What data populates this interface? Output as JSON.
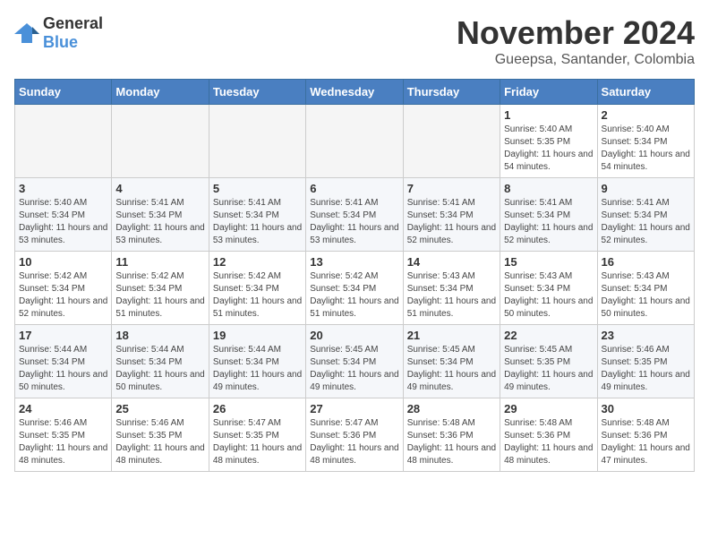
{
  "logo": {
    "general": "General",
    "blue": "Blue"
  },
  "title": "November 2024",
  "location": "Gueepsa, Santander, Colombia",
  "weekdays": [
    "Sunday",
    "Monday",
    "Tuesday",
    "Wednesday",
    "Thursday",
    "Friday",
    "Saturday"
  ],
  "weeks": [
    [
      {
        "day": "",
        "info": ""
      },
      {
        "day": "",
        "info": ""
      },
      {
        "day": "",
        "info": ""
      },
      {
        "day": "",
        "info": ""
      },
      {
        "day": "",
        "info": ""
      },
      {
        "day": "1",
        "info": "Sunrise: 5:40 AM\nSunset: 5:35 PM\nDaylight: 11 hours and 54 minutes."
      },
      {
        "day": "2",
        "info": "Sunrise: 5:40 AM\nSunset: 5:34 PM\nDaylight: 11 hours and 54 minutes."
      }
    ],
    [
      {
        "day": "3",
        "info": "Sunrise: 5:40 AM\nSunset: 5:34 PM\nDaylight: 11 hours and 53 minutes."
      },
      {
        "day": "4",
        "info": "Sunrise: 5:41 AM\nSunset: 5:34 PM\nDaylight: 11 hours and 53 minutes."
      },
      {
        "day": "5",
        "info": "Sunrise: 5:41 AM\nSunset: 5:34 PM\nDaylight: 11 hours and 53 minutes."
      },
      {
        "day": "6",
        "info": "Sunrise: 5:41 AM\nSunset: 5:34 PM\nDaylight: 11 hours and 53 minutes."
      },
      {
        "day": "7",
        "info": "Sunrise: 5:41 AM\nSunset: 5:34 PM\nDaylight: 11 hours and 52 minutes."
      },
      {
        "day": "8",
        "info": "Sunrise: 5:41 AM\nSunset: 5:34 PM\nDaylight: 11 hours and 52 minutes."
      },
      {
        "day": "9",
        "info": "Sunrise: 5:41 AM\nSunset: 5:34 PM\nDaylight: 11 hours and 52 minutes."
      }
    ],
    [
      {
        "day": "10",
        "info": "Sunrise: 5:42 AM\nSunset: 5:34 PM\nDaylight: 11 hours and 52 minutes."
      },
      {
        "day": "11",
        "info": "Sunrise: 5:42 AM\nSunset: 5:34 PM\nDaylight: 11 hours and 51 minutes."
      },
      {
        "day": "12",
        "info": "Sunrise: 5:42 AM\nSunset: 5:34 PM\nDaylight: 11 hours and 51 minutes."
      },
      {
        "day": "13",
        "info": "Sunrise: 5:42 AM\nSunset: 5:34 PM\nDaylight: 11 hours and 51 minutes."
      },
      {
        "day": "14",
        "info": "Sunrise: 5:43 AM\nSunset: 5:34 PM\nDaylight: 11 hours and 51 minutes."
      },
      {
        "day": "15",
        "info": "Sunrise: 5:43 AM\nSunset: 5:34 PM\nDaylight: 11 hours and 50 minutes."
      },
      {
        "day": "16",
        "info": "Sunrise: 5:43 AM\nSunset: 5:34 PM\nDaylight: 11 hours and 50 minutes."
      }
    ],
    [
      {
        "day": "17",
        "info": "Sunrise: 5:44 AM\nSunset: 5:34 PM\nDaylight: 11 hours and 50 minutes."
      },
      {
        "day": "18",
        "info": "Sunrise: 5:44 AM\nSunset: 5:34 PM\nDaylight: 11 hours and 50 minutes."
      },
      {
        "day": "19",
        "info": "Sunrise: 5:44 AM\nSunset: 5:34 PM\nDaylight: 11 hours and 49 minutes."
      },
      {
        "day": "20",
        "info": "Sunrise: 5:45 AM\nSunset: 5:34 PM\nDaylight: 11 hours and 49 minutes."
      },
      {
        "day": "21",
        "info": "Sunrise: 5:45 AM\nSunset: 5:34 PM\nDaylight: 11 hours and 49 minutes."
      },
      {
        "day": "22",
        "info": "Sunrise: 5:45 AM\nSunset: 5:35 PM\nDaylight: 11 hours and 49 minutes."
      },
      {
        "day": "23",
        "info": "Sunrise: 5:46 AM\nSunset: 5:35 PM\nDaylight: 11 hours and 49 minutes."
      }
    ],
    [
      {
        "day": "24",
        "info": "Sunrise: 5:46 AM\nSunset: 5:35 PM\nDaylight: 11 hours and 48 minutes."
      },
      {
        "day": "25",
        "info": "Sunrise: 5:46 AM\nSunset: 5:35 PM\nDaylight: 11 hours and 48 minutes."
      },
      {
        "day": "26",
        "info": "Sunrise: 5:47 AM\nSunset: 5:35 PM\nDaylight: 11 hours and 48 minutes."
      },
      {
        "day": "27",
        "info": "Sunrise: 5:47 AM\nSunset: 5:36 PM\nDaylight: 11 hours and 48 minutes."
      },
      {
        "day": "28",
        "info": "Sunrise: 5:48 AM\nSunset: 5:36 PM\nDaylight: 11 hours and 48 minutes."
      },
      {
        "day": "29",
        "info": "Sunrise: 5:48 AM\nSunset: 5:36 PM\nDaylight: 11 hours and 48 minutes."
      },
      {
        "day": "30",
        "info": "Sunrise: 5:48 AM\nSunset: 5:36 PM\nDaylight: 11 hours and 47 minutes."
      }
    ]
  ]
}
